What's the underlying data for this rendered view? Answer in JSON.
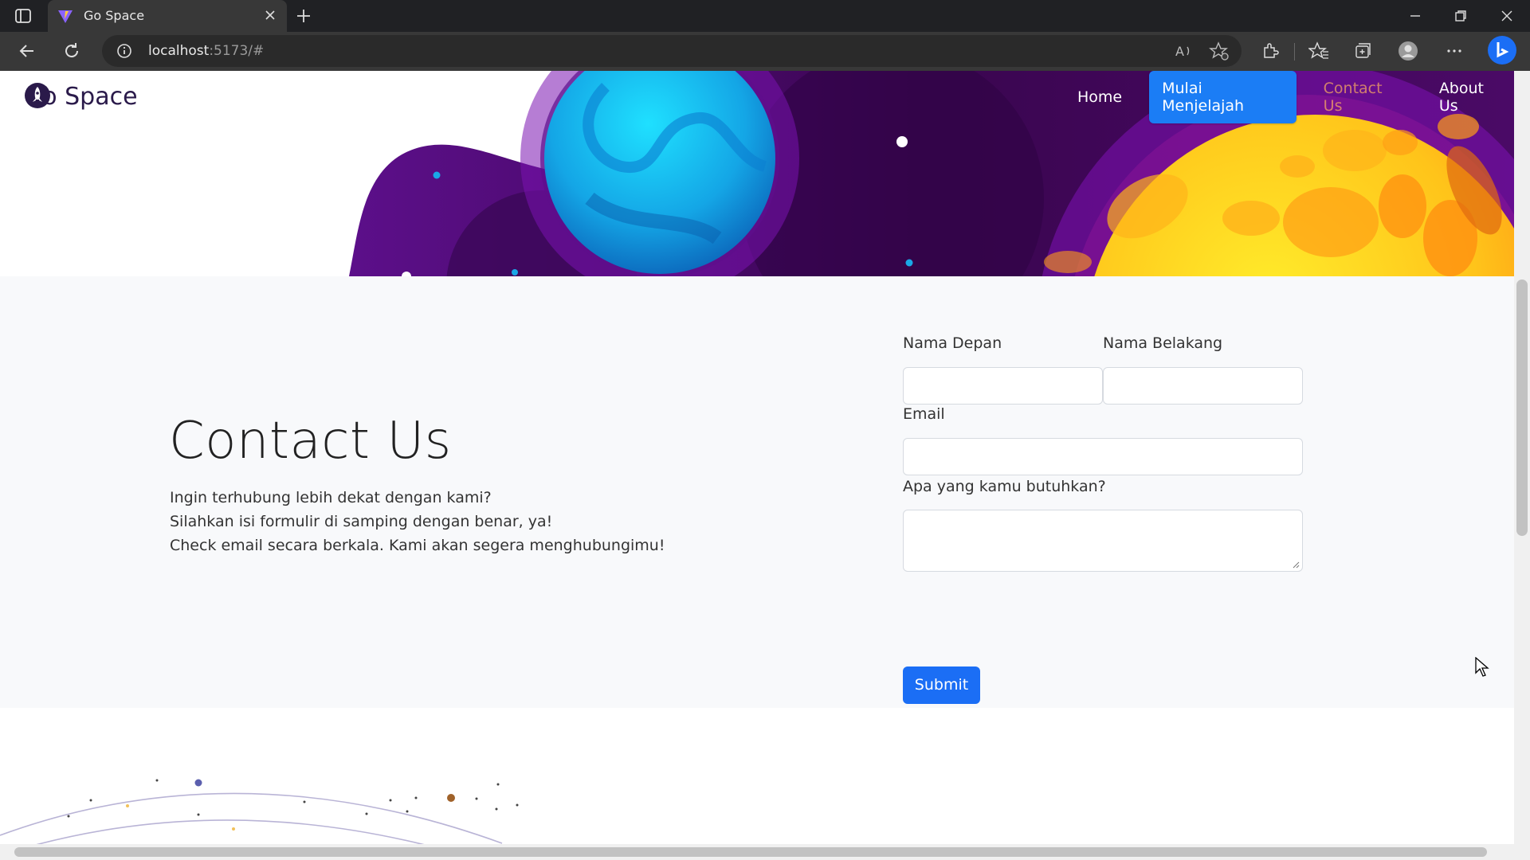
{
  "browser": {
    "tab_title": "Go Space",
    "url_host": "localhost",
    "url_rest": ":5173/#",
    "icons": [
      "sidebar-icon",
      "vite-favicon",
      "close-icon",
      "new-tab-icon",
      "minimize-icon",
      "restore-icon",
      "window-close-icon",
      "back-icon",
      "refresh-icon",
      "info-icon",
      "read-aloud-icon",
      "add-favorite-icon",
      "extensions-icon",
      "favorites-icon",
      "collections-icon",
      "profile-icon",
      "more-icon",
      "bing-icon"
    ]
  },
  "navbar": {
    "brand": "Go Space",
    "links": {
      "home": "Home",
      "cta": "Mulai Menjelajah",
      "contact": "Contact Us",
      "about": "About Us"
    }
  },
  "contact": {
    "title": "Contact Us",
    "lines": [
      "Ingin terhubung lebih dekat dengan kami?",
      "Silahkan isi formulir di samping dengan benar, ya!",
      "Check email secara berkala. Kami akan segera menghubungimu!"
    ]
  },
  "form": {
    "first_name_label": "Nama Depan",
    "first_name_value": "",
    "last_name_label": "Nama Belakang",
    "last_name_value": "",
    "email_label": "Email",
    "email_value": "",
    "message_label": "Apa yang kamu butuhkan?",
    "message_value": "",
    "submit_label": "Submit"
  },
  "colors": {
    "accent": "#1b6ef5",
    "space_purple": "#4a0a6e",
    "planet_yellow": "#ffd21e",
    "planet_blue": "#1aa8e6"
  }
}
